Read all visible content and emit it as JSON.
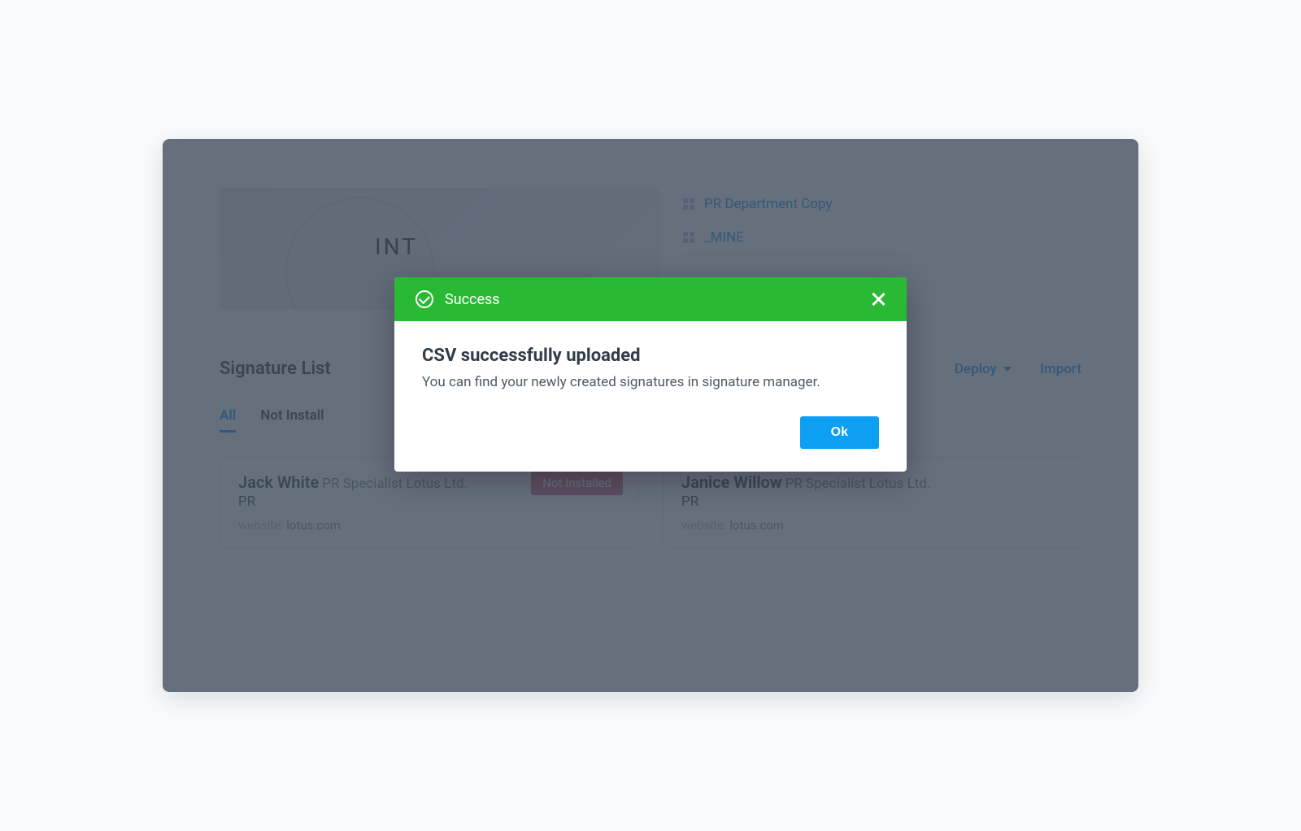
{
  "background": {
    "banner_text": "INT",
    "side_items": [
      {
        "label": "PR Department Copy"
      },
      {
        "label": "_MINE"
      }
    ],
    "section_title": "Signature List",
    "actions": {
      "deploy": "Deploy",
      "import": "Import"
    },
    "tabs": {
      "all": "All",
      "not_installed": "Not Install"
    },
    "cards": [
      {
        "name": "Jack White",
        "role": "PR Specialist Lotus Ltd.",
        "line2": "PR",
        "website_label": "website:",
        "website": "lotus.com",
        "badge": "Not Installed"
      },
      {
        "name": "Janice Willow",
        "role": "PR Specialist Lotus Ltd.",
        "line2": "PR",
        "website_label": "website:",
        "website": "lotus.com"
      }
    ]
  },
  "modal": {
    "header_title": "Success",
    "heading": "CSV successfully uploaded",
    "text": "You can find your newly created signatures in signature manager.",
    "ok_label": "Ok"
  }
}
